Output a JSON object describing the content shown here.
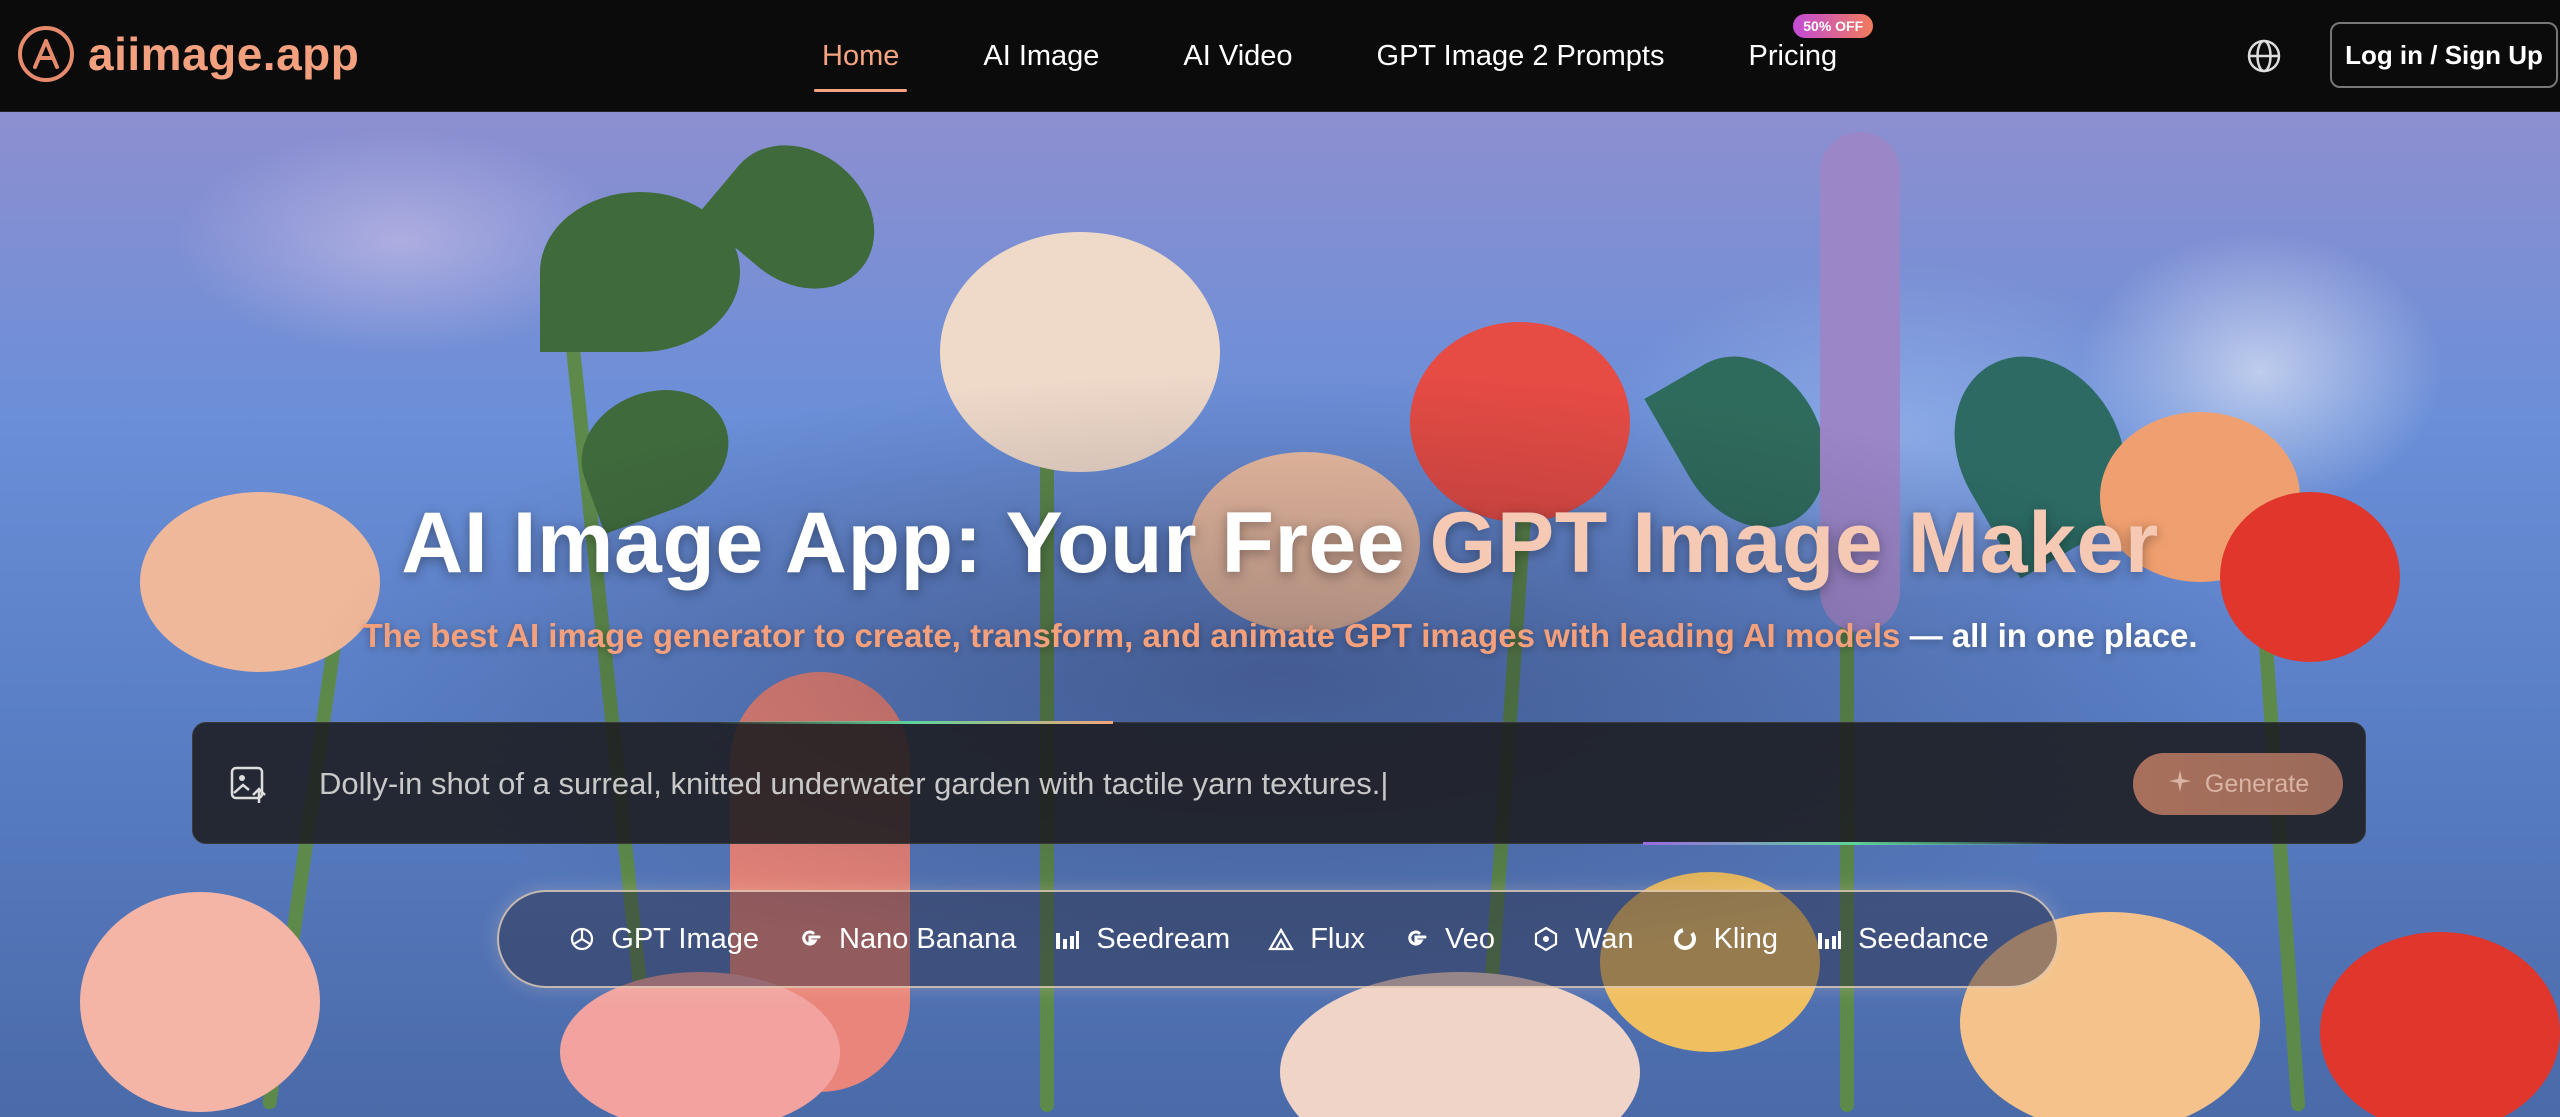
{
  "brand": {
    "name": "aiimage.app",
    "accent": "#f2a07e"
  },
  "nav": {
    "links": [
      {
        "label": "Home",
        "active": true
      },
      {
        "label": "AI Image"
      },
      {
        "label": "AI Video"
      },
      {
        "label": "GPT Image 2 Prompts"
      },
      {
        "label": "Pricing",
        "badge": "50% OFF"
      }
    ],
    "login": "Log in / Sign Up",
    "language_icon": "globe-icon"
  },
  "hero": {
    "title_white": "AI Image App: Your Free ",
    "title_peach": "GPT Image Maker",
    "subtitle_peach": "The best AI image generator to create, transform, and animate GPT images with leading AI models ",
    "subtitle_white": "— all in one place.",
    "prompt": {
      "value": "Dolly-in shot of a surreal, knitted underwater garden with tactile yarn textures.|",
      "upload_icon": "image-upload-icon",
      "generate_label": "Generate"
    },
    "models": [
      {
        "label": "GPT Image",
        "icon": "openai-icon"
      },
      {
        "label": "Nano Banana",
        "icon": "google-icon"
      },
      {
        "label": "Seedream",
        "icon": "bars-icon"
      },
      {
        "label": "Flux",
        "icon": "flux-icon"
      },
      {
        "label": "Veo",
        "icon": "google-icon"
      },
      {
        "label": "Wan",
        "icon": "wan-icon"
      },
      {
        "label": "Kling",
        "icon": "kling-icon"
      },
      {
        "label": "Seedance",
        "icon": "bars-icon"
      }
    ]
  }
}
